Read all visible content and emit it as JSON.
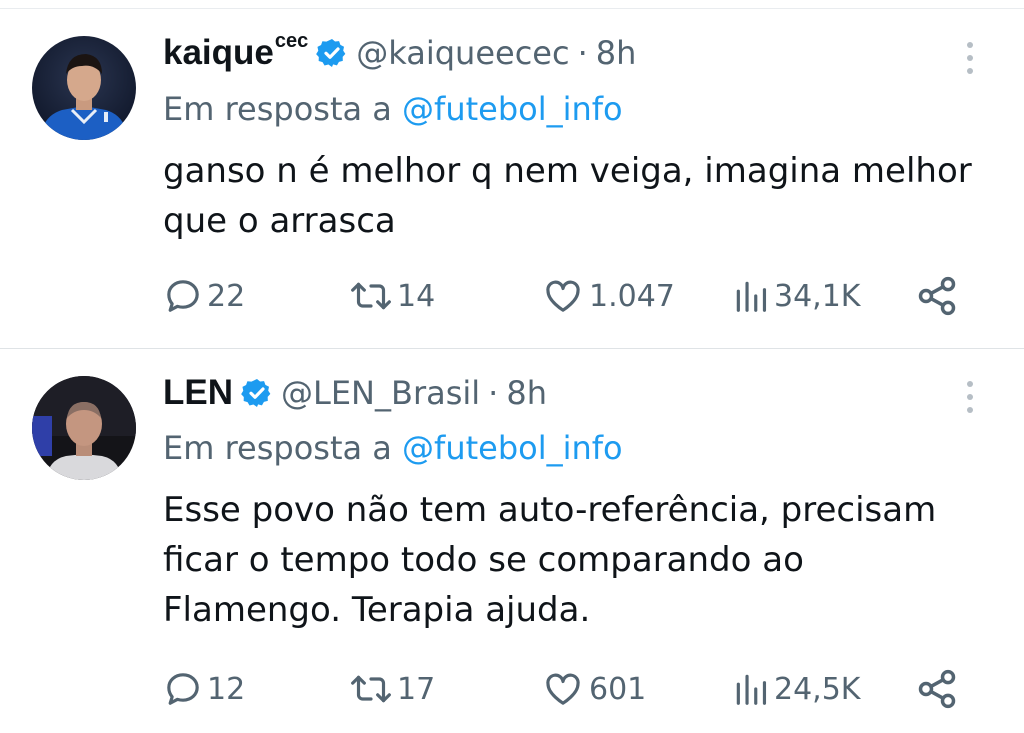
{
  "tweets": [
    {
      "name": "kaique",
      "name_sup": "cec",
      "handle": "@kaiqueecec",
      "separator": "·",
      "time": "8h",
      "reply_prefix": "Em resposta a",
      "reply_mention": "@futebol_info",
      "body_lines": [
        "ganso n é melhor q nem veiga, imagina melhor",
        "que o arrasca"
      ],
      "stats": {
        "replies": "22",
        "retweets": "14",
        "likes": "1.047",
        "views": "34,1K"
      }
    },
    {
      "name": "LEN",
      "handle": "@LEN_Brasil",
      "separator": "·",
      "time": "8h",
      "reply_prefix": "Em resposta a",
      "reply_mention": "@futebol_info",
      "body_lines": [
        "Esse povo não tem auto-referência, precisam",
        "ficar o tempo todo se comparando ao",
        "Flamengo. Terapia ajuda."
      ],
      "stats": {
        "replies": "12",
        "retweets": "17",
        "likes": "601",
        "views": "24,5K"
      }
    }
  ],
  "colors": {
    "verified": "#1d9bf0",
    "mention": "#1d9bf0",
    "secondary_text": "#536471"
  },
  "icons": [
    "verified-badge-icon",
    "more-options-icon",
    "reply-icon",
    "retweet-icon",
    "like-icon",
    "views-icon",
    "share-icon"
  ]
}
